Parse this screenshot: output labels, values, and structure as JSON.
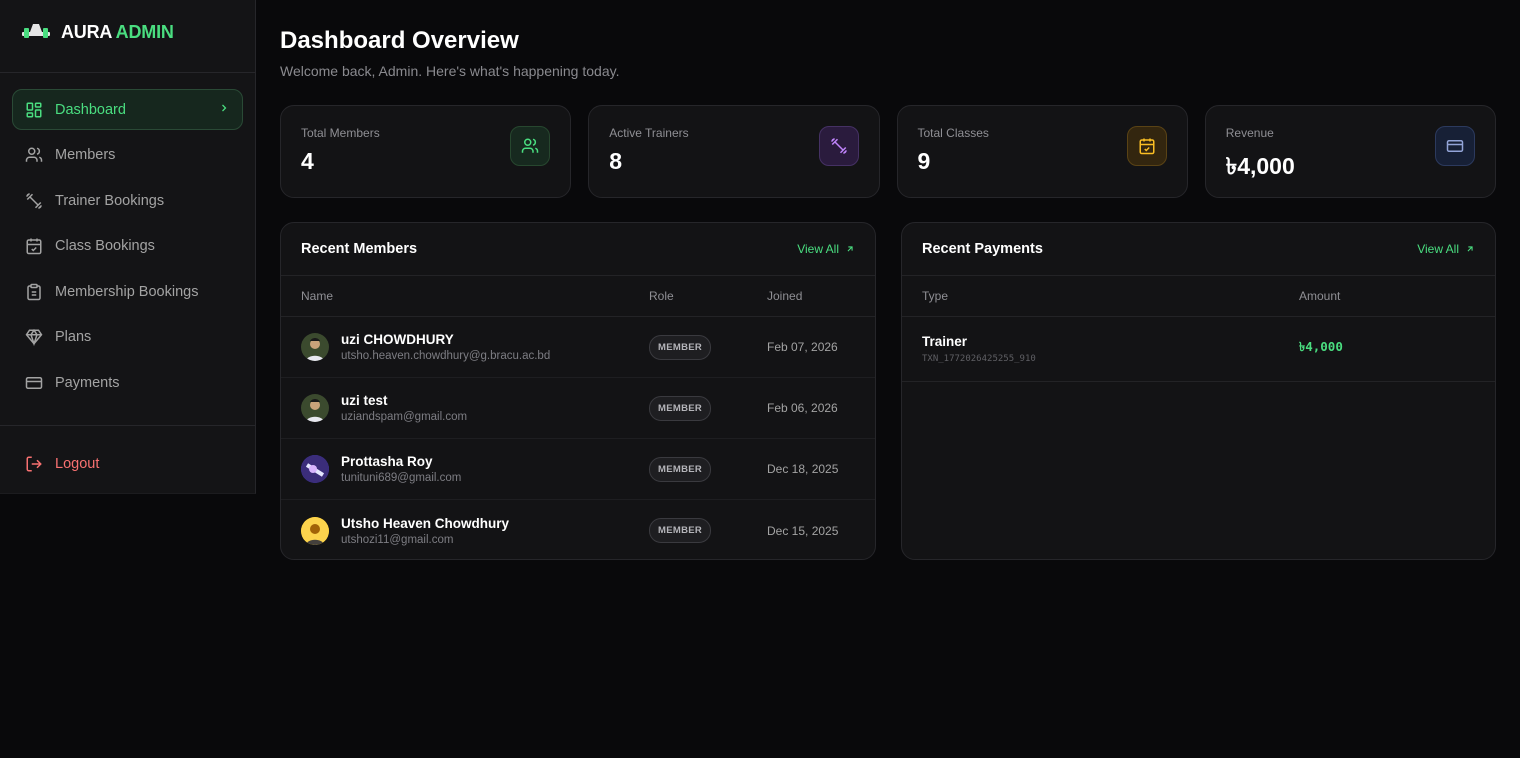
{
  "brand": {
    "part1": "AURA",
    "part2": "ADMIN"
  },
  "sidebar": {
    "items": [
      {
        "label": "Dashboard",
        "icon": "grid-icon",
        "active": true
      },
      {
        "label": "Members",
        "icon": "users-icon"
      },
      {
        "label": "Trainer Bookings",
        "icon": "dumbbell-icon"
      },
      {
        "label": "Class Bookings",
        "icon": "calendar-check-icon"
      },
      {
        "label": "Membership Bookings",
        "icon": "clipboard-icon"
      },
      {
        "label": "Plans",
        "icon": "diamond-icon"
      },
      {
        "label": "Payments",
        "icon": "credit-card-icon"
      }
    ],
    "logout": "Logout"
  },
  "header": {
    "title": "Dashboard Overview",
    "subtitle": "Welcome back, Admin. Here's what's happening today."
  },
  "stats": [
    {
      "label": "Total Members",
      "value": "4",
      "icon": "users-icon",
      "color": "#4ade80"
    },
    {
      "label": "Active Trainers",
      "value": "8",
      "icon": "dumbbell-icon",
      "color": "#c084fc"
    },
    {
      "label": "Total Classes",
      "value": "9",
      "icon": "calendar-check-icon",
      "color": "#fbbf24"
    },
    {
      "label": "Revenue",
      "value": "৳4,000",
      "icon": "credit-card-icon",
      "color": "#93a4d8"
    }
  ],
  "recent_members": {
    "title": "Recent Members",
    "view_all": "View All",
    "columns": [
      "Name",
      "Role",
      "Joined"
    ],
    "rows": [
      {
        "name": "uzi CHOWDHURY",
        "email": "utsho.heaven.chowdhury@g.bracu.ac.bd",
        "role": "MEMBER",
        "joined": "Feb 07, 2026"
      },
      {
        "name": "uzi test",
        "email": "uziandspam@gmail.com",
        "role": "MEMBER",
        "joined": "Feb 06, 2026"
      },
      {
        "name": "Prottasha Roy",
        "email": "tunituni689@gmail.com",
        "role": "MEMBER",
        "joined": "Dec 18, 2025"
      },
      {
        "name": "Utsho Heaven Chowdhury",
        "email": "utshozi11@gmail.com",
        "role": "MEMBER",
        "joined": "Dec 15, 2025"
      }
    ]
  },
  "recent_payments": {
    "title": "Recent Payments",
    "view_all": "View All",
    "columns": [
      "Type",
      "Amount"
    ],
    "rows": [
      {
        "type": "Trainer",
        "txn": "TXN_1772026425255_910",
        "amount": "৳4,000"
      }
    ]
  }
}
